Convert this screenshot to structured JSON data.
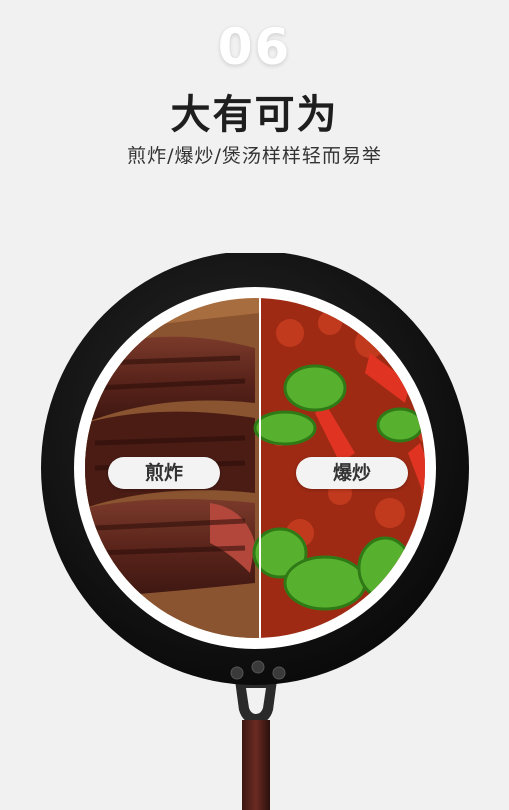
{
  "header": {
    "number": "06",
    "title": "大有可为",
    "subtitle": "煎炸/爆炒/煲汤样样轻而易举"
  },
  "labels": {
    "left": "煎炸",
    "right": "爆炒"
  },
  "colors": {
    "background": "#f1f1f1",
    "pan_body": "#151515",
    "pill_bg": "#f3f3f3"
  }
}
